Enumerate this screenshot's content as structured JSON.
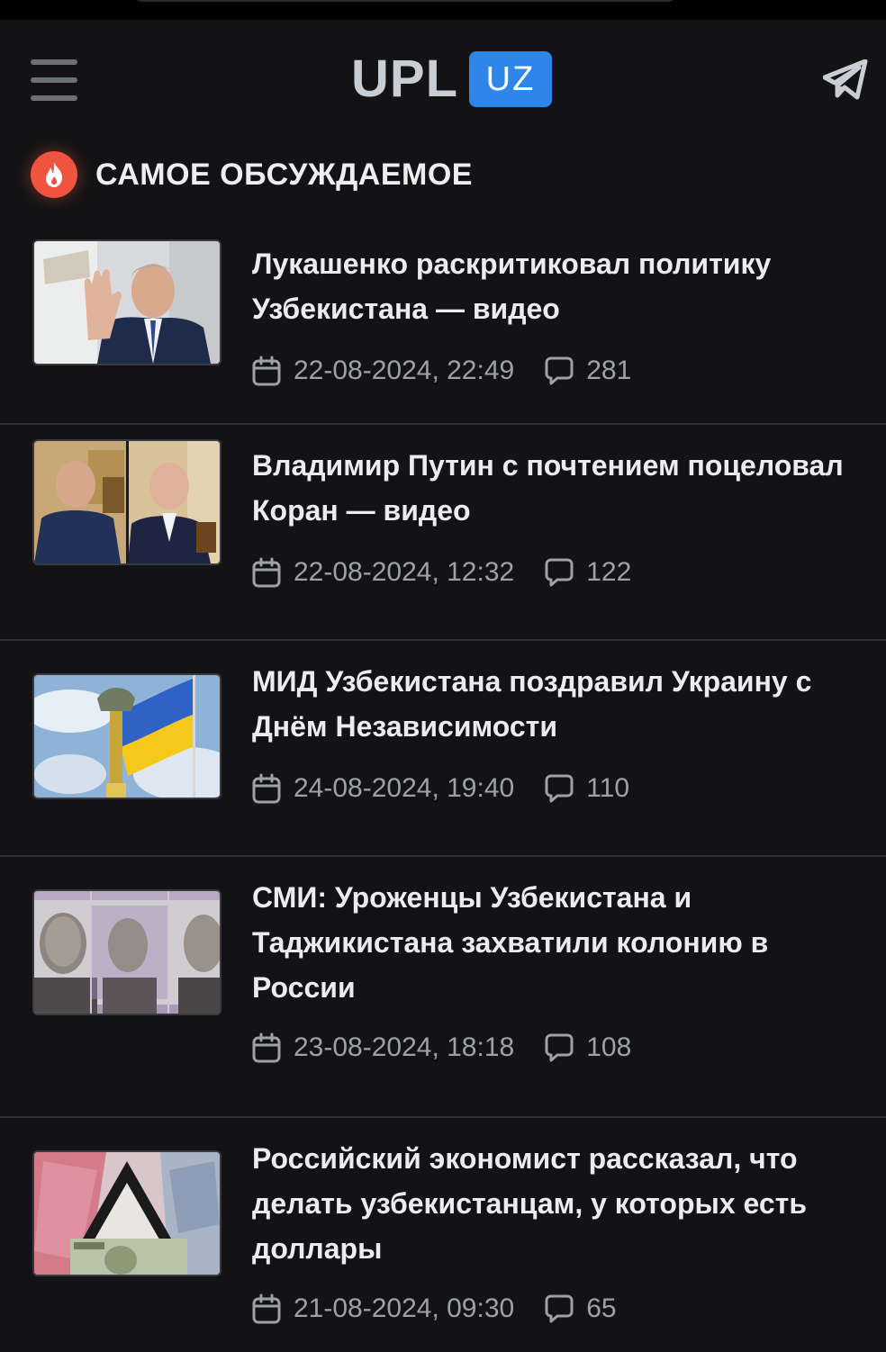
{
  "header": {
    "logo_text": "UPL",
    "logo_badge": "UZ",
    "menu_icon": "hamburger-menu-icon",
    "telegram_icon": "telegram-icon"
  },
  "section": {
    "icon": "fire-icon",
    "title": "САМОЕ ОБСУЖДАЕМОЕ"
  },
  "colors": {
    "background": "#131315",
    "accent_blue": "#2e86e8",
    "fire_red": "#f0533e",
    "meta_gray": "#9da1a8",
    "divider": "#2f3033"
  },
  "articles": [
    {
      "title": "Лукашенко раскритиковал политику Узбекистана — видео",
      "date": "22-08-2024, 22:49",
      "comments": "281",
      "thumbnail": "man-waving-photo"
    },
    {
      "title": "Владимир Путин с почтением поцеловал Коран — видео",
      "date": "22-08-2024, 12:32",
      "comments": "122",
      "thumbnail": "two-panel-photo"
    },
    {
      "title": "МИД Узбекистана поздравил Украину с Днём Независимости",
      "date": "24-08-2024, 19:40",
      "comments": "110",
      "thumbnail": "ukraine-flag-monument-photo"
    },
    {
      "title": "СМИ: Уроженцы Узбекистана и Таджикистана захватили колонию в России",
      "date": "23-08-2024, 18:18",
      "comments": "108",
      "thumbnail": "three-faces-photo"
    },
    {
      "title": "Российский экономист рассказал, что делать узбекистанцам, у которых есть доллары",
      "date": "21-08-2024, 09:30",
      "comments": "65",
      "thumbnail": "banknotes-photo"
    }
  ]
}
